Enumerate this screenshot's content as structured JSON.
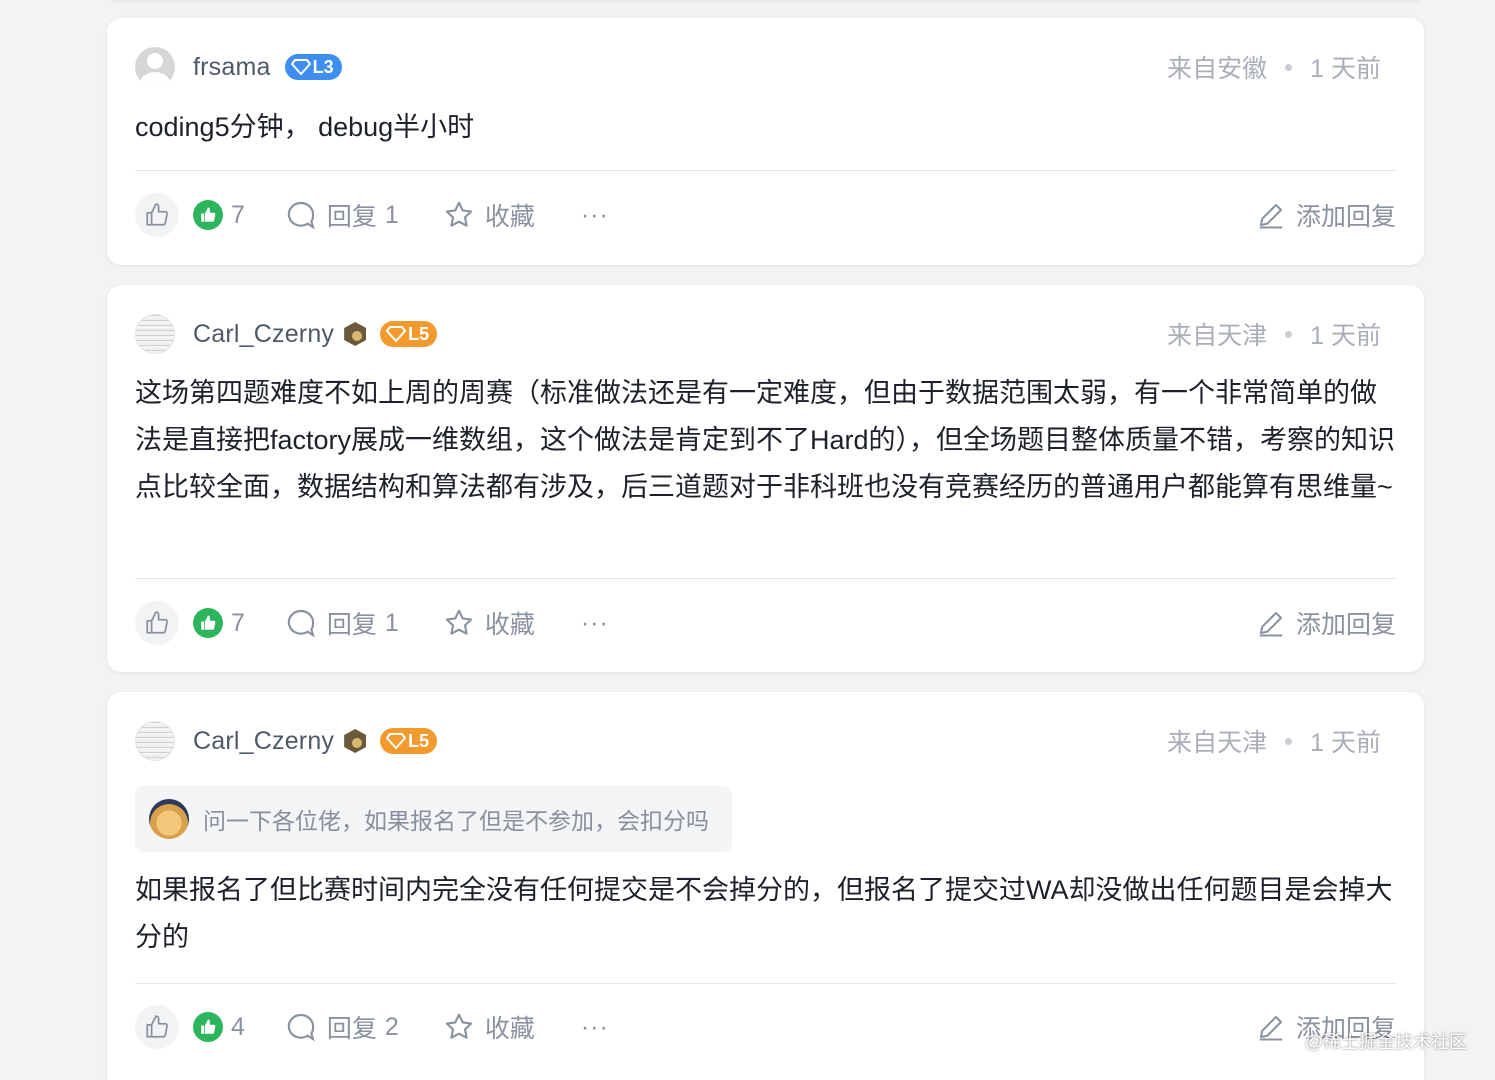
{
  "comments": [
    {
      "username": "frsama",
      "level": "L3",
      "location": "来自安徽",
      "time": "1 天前",
      "content": "coding5分钟， debug半小时",
      "likes": "7",
      "reply_label": "回复",
      "replies": "1",
      "fav_label": "收藏",
      "more": "···",
      "add_reply": "添加回复"
    },
    {
      "username": "Carl_Czerny",
      "level": "L5",
      "location": "来自天津",
      "time": "1 天前",
      "content": "这场第四题难度不如上周的周赛（标准做法还是有一定难度，但由于数据范围太弱，有一个非常简单的做法是直接把factory展成一维数组，这个做法是肯定到不了Hard的），但全场题目整体质量不错，考察的知识点比较全面，数据结构和算法都有涉及，后三道题对于非科班也没有竞赛经历的普通用户都能算有思维量~",
      "likes": "7",
      "reply_label": "回复",
      "replies": "1",
      "fav_label": "收藏",
      "more": "···",
      "add_reply": "添加回复"
    },
    {
      "username": "Carl_Czerny",
      "level": "L5",
      "location": "来自天津",
      "time": "1 天前",
      "quote": "问一下各位佬，如果报名了但是不参加，会扣分吗",
      "content": "如果报名了但比赛时间内完全没有任何提交是不会掉分的，但报名了提交过WA却没做出任何题目是会掉大分的",
      "likes": "4",
      "reply_label": "回复",
      "replies": "2",
      "fav_label": "收藏",
      "more": "···",
      "add_reply": "添加回复"
    }
  ],
  "watermark": "@稀土掘金技术社区",
  "colors": {
    "like_green": "#2db55d",
    "level_blue": "#3d8ef0",
    "level_orange": "#f29a2e",
    "muted": "#8a919f"
  }
}
